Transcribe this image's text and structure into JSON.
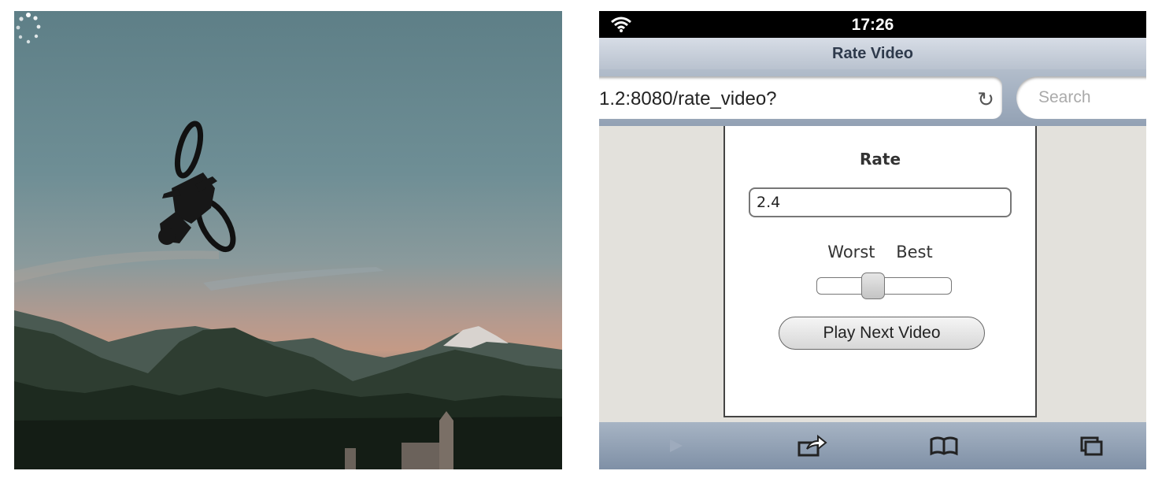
{
  "status_bar": {
    "time": "17:26",
    "wifi_icon": "wifi-icon"
  },
  "browser": {
    "page_title": "Rate Video",
    "url": "1.2:8080/rate_video?",
    "reload_icon": "reload-icon",
    "search_placeholder": "Search"
  },
  "page": {
    "heading": "Rate",
    "rate_value": "2.4",
    "worst_label": "Worst",
    "best_label": "Best",
    "slider_value_fraction": 0.4,
    "play_next_label": "Play Next Video"
  },
  "toolbar": {
    "icons": [
      "play-forward-icon",
      "share-icon",
      "bookmarks-icon",
      "tabs-icon"
    ]
  },
  "colors": {
    "status_bar": "#000000",
    "title_bar": "#c7cfdb",
    "toolbar": "#8d9db1",
    "page_bg": "#e3e1dc"
  }
}
